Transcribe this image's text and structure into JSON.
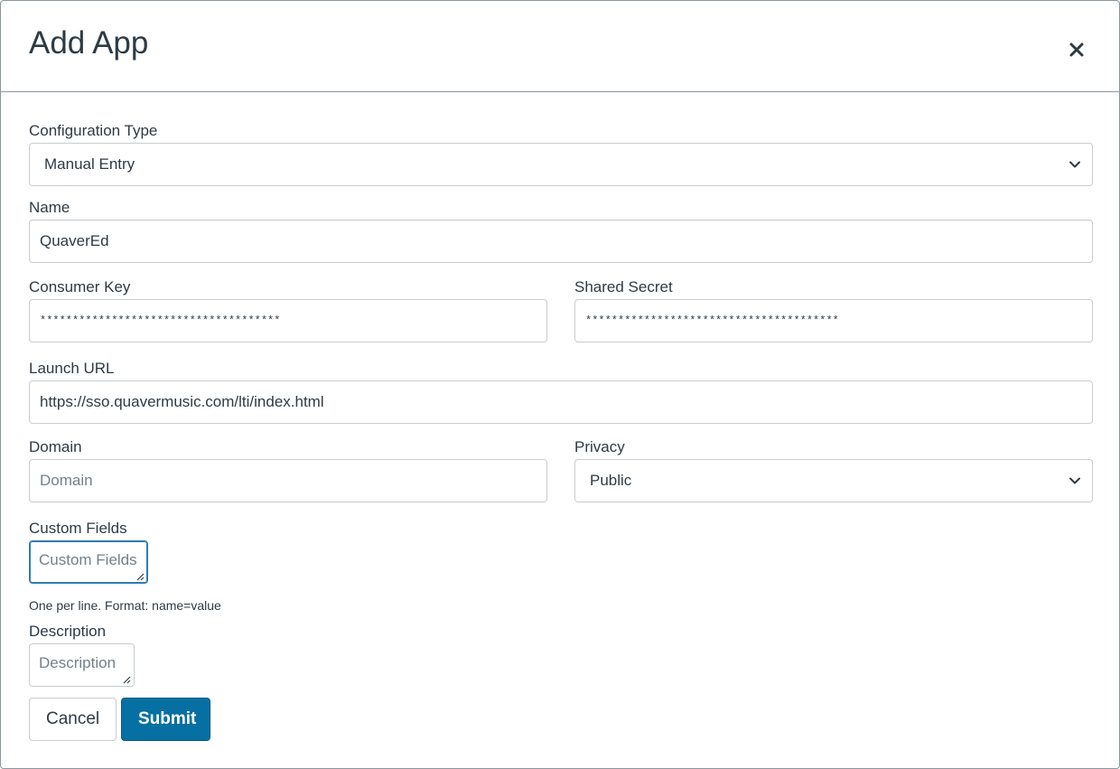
{
  "dialog": {
    "title": "Add App",
    "close_glyph": "✕",
    "close_icon": "close-icon"
  },
  "form": {
    "configuration_type": {
      "label": "Configuration Type",
      "value": "Manual Entry"
    },
    "name": {
      "label": "Name",
      "value": "QuaverEd"
    },
    "consumer_key": {
      "label": "Consumer Key",
      "value": "*************************************"
    },
    "shared_secret": {
      "label": "Shared Secret",
      "value": "***************************************"
    },
    "launch_url": {
      "label": "Launch URL",
      "value": "https://sso.quavermusic.com/lti/index.html"
    },
    "domain": {
      "label": "Domain",
      "placeholder": "Domain",
      "value": ""
    },
    "privacy": {
      "label": "Privacy",
      "value": "Public"
    },
    "custom_fields": {
      "label": "Custom Fields",
      "placeholder": "Custom Fields",
      "hint": "One per line. Format: name=value"
    },
    "description": {
      "label": "Description",
      "placeholder": "Description"
    }
  },
  "actions": {
    "cancel_label": "Cancel",
    "submit_label": "Submit"
  },
  "colors": {
    "text": "#2d3b45",
    "border": "#c7cdd1",
    "submit_bg": "#0770a3",
    "focus": "#2d7cb5"
  }
}
